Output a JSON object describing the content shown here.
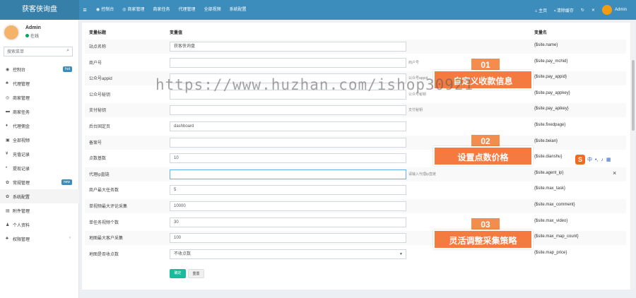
{
  "topbar": {
    "brand": "获客侠询盘",
    "menu_toggle": "≡",
    "nav": [
      {
        "icon": "dashboard-icon",
        "glyph": "◉",
        "label": "控制台"
      },
      {
        "icon": "eye-icon",
        "glyph": "◎",
        "label": "商家管理"
      },
      {
        "icon": "",
        "glyph": "",
        "label": "商家任务"
      },
      {
        "icon": "",
        "glyph": "",
        "label": "代理管理"
      },
      {
        "icon": "",
        "glyph": "",
        "label": "全部视频"
      },
      {
        "icon": "",
        "glyph": "",
        "label": "系统配置"
      }
    ],
    "right": {
      "home": "主页",
      "home_glyph": "⌂",
      "clear_cache": "清除缓存",
      "clear_glyph": "▪",
      "refresh_glyph": "↻",
      "fullscreen_glyph": "✕",
      "user": "Admin"
    }
  },
  "sidebar": {
    "user_name": "Admin",
    "user_status": "在线",
    "search_placeholder": "搜索菜单",
    "search_glyph": "⌕",
    "items": [
      {
        "glyph": "◉",
        "label": "控制台",
        "icon": "dashboard-icon",
        "badge": "hot",
        "badge_color": "#3c8dbc"
      },
      {
        "glyph": "♣",
        "label": "代理管理",
        "icon": "users-icon"
      },
      {
        "glyph": "◎",
        "label": "商家管理",
        "icon": "eye-icon"
      },
      {
        "glyph": "▬",
        "label": "商家任务",
        "icon": "task-icon"
      },
      {
        "glyph": "♦",
        "label": "代理佣金",
        "icon": "diamond-icon"
      },
      {
        "glyph": "▣",
        "label": "全部视频",
        "icon": "video-icon"
      },
      {
        "glyph": "¥",
        "label": "充值记录",
        "icon": "yen-icon"
      },
      {
        "glyph": "•",
        "label": "提现记录",
        "icon": "dot-icon"
      },
      {
        "glyph": "✿",
        "label": "常规管理",
        "icon": "gears-icon",
        "badge": "new",
        "badge_color": "#3c8dbc"
      },
      {
        "glyph": "✿",
        "label": "系统配置",
        "icon": "gear-icon",
        "active": true
      },
      {
        "glyph": "▤",
        "label": "附件管理",
        "icon": "file-icon"
      },
      {
        "glyph": "♟",
        "label": "个人资料",
        "icon": "user-icon"
      },
      {
        "glyph": "♣",
        "label": "权限管理",
        "icon": "group-icon",
        "chevron": "‹"
      }
    ]
  },
  "table": {
    "headers": {
      "title": "变量标题",
      "value": "变量值",
      "name": "变量名"
    },
    "rows": [
      {
        "label": "站点名称",
        "value": "获客侠询盘",
        "help": "",
        "var": "{$site.name}"
      },
      {
        "label": "商户号",
        "value": "",
        "help": "商户号",
        "var": "{$site.pay_mchid}"
      },
      {
        "label": "公众号appid",
        "value": "",
        "help": "公众号appid",
        "var": "{$site.pay_appid}"
      },
      {
        "label": "公众号秘钥",
        "value": "",
        "help": "公众号秘钥",
        "var": "{$site.pay_appkey}"
      },
      {
        "label": "支付秘钥",
        "value": "",
        "help": "支付秘钥",
        "var": "{$site.pay_apikey}"
      },
      {
        "label": "后台固定页",
        "value": "dashboard",
        "help": "",
        "var": "{$site.fixedpage}"
      },
      {
        "label": "备案号",
        "value": "",
        "help": "",
        "var": "{$site.beian}"
      },
      {
        "label": "点数基数",
        "value": "10",
        "help": "",
        "var": "{$site.dianshu}"
      },
      {
        "label": "代理ip直链",
        "value": "",
        "help": "请输入代理ip直链",
        "var": "{$site.agent_ip}",
        "focus": true
      },
      {
        "label": "商户最大任务数",
        "value": "5",
        "help": "",
        "var": "{$site.max_task}"
      },
      {
        "label": "单视频最大评论采集",
        "value": "10000",
        "help": "",
        "var": "{$site.max_comment}"
      },
      {
        "label": "单任务视频个数",
        "value": "30",
        "help": "",
        "var": "{$site.max_video}"
      },
      {
        "label": "地图最大客户采集",
        "value": "100",
        "help": "",
        "var": "{$site.max_map_count}"
      },
      {
        "label": "地图是否收点数",
        "value": "不收点数",
        "help": "",
        "var": "{$site.map_price}",
        "select": true
      }
    ],
    "ok_button": "确定",
    "reset_button": "重置"
  },
  "callouts": [
    {
      "num": "01",
      "text": "自定义收款信息"
    },
    {
      "num": "02",
      "text": "设置点数价格"
    },
    {
      "num": "03",
      "text": "灵活调整采集策略"
    }
  ],
  "watermark": "https://www.huzhan.com/ishop30921",
  "ime": {
    "logo": "S",
    "lang": "中",
    "punct": "•,",
    "mic": "♪",
    "kb": "▦"
  },
  "close_glyph": "×"
}
